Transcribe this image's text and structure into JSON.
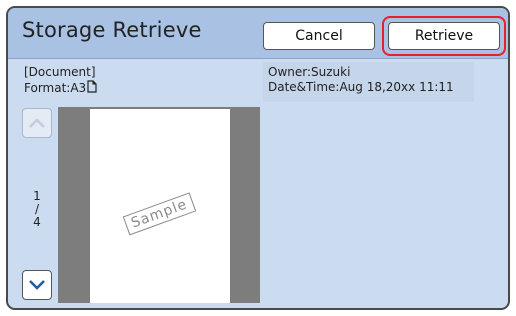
{
  "header": {
    "title": "Storage Retrieve",
    "cancel_label": "Cancel",
    "retrieve_label": "Retrieve"
  },
  "document_info": {
    "type_label": "[Document]",
    "format_label": "Format:A3",
    "format_icon": "portrait-page-icon",
    "owner_label": "Owner:Suzuki",
    "datetime_label": "Date&Time:Aug 18,20xx 11:11"
  },
  "pager": {
    "current": "1",
    "separator": "/",
    "total": "4",
    "up_icon": "chevron-up-icon",
    "down_icon": "chevron-down-icon"
  },
  "preview": {
    "stamp_text": "Sample"
  },
  "colors": {
    "screen_bg": "#ccdcf0",
    "header_bg": "#a9c1e3",
    "highlight": "#e8202a",
    "chevron": "#1f5fa8"
  }
}
